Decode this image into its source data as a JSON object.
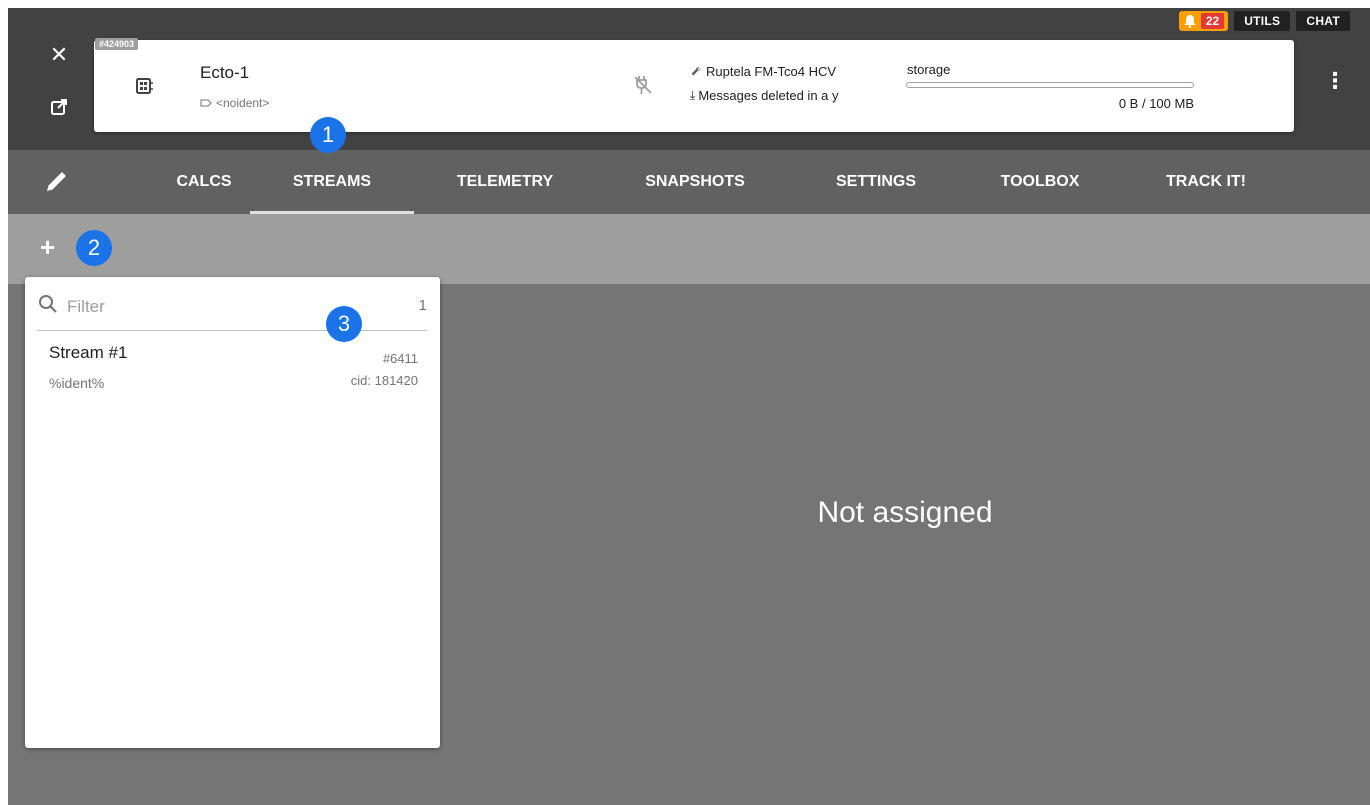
{
  "header": {
    "unit_id": "#424903",
    "unit_name": "Ecto-1",
    "unit_ident": "<noident>",
    "device_type": "Ruptela FM-Tco4 HCV",
    "retention_text": "Messages deleted in a y",
    "storage_label": "storage",
    "storage_value": "0 B / 100 MB",
    "storage_used_fraction": 0.0,
    "notifications_count": "22",
    "utils_label": "UTILS",
    "chat_label": "CHAT"
  },
  "tabs": [
    {
      "label": "CALCS",
      "active": false
    },
    {
      "label": "STREAMS",
      "active": true
    },
    {
      "label": "TELEMETRY",
      "active": false
    },
    {
      "label": "SNAPSHOTS",
      "active": false
    },
    {
      "label": "SETTINGS",
      "active": false
    },
    {
      "label": "TOOLBOX",
      "active": false
    },
    {
      "label": "TRACK IT!",
      "active": false
    }
  ],
  "list": {
    "filter_placeholder": "Filter",
    "count": "1",
    "items": [
      {
        "name": "Stream #1",
        "ident": "%ident%",
        "id": "#6411",
        "cid": "cid: 181420"
      }
    ]
  },
  "main": {
    "empty_message": "Not assigned"
  },
  "markers": [
    "1",
    "2",
    "3"
  ],
  "colors": {
    "header_bg": "#424242",
    "tabs_bg": "#616161",
    "actionbar_bg": "#9e9e9e",
    "content_bg": "#757575",
    "notification_orange": "#ffa000",
    "notification_red": "#e53935",
    "marker_blue": "#1a73e8"
  }
}
